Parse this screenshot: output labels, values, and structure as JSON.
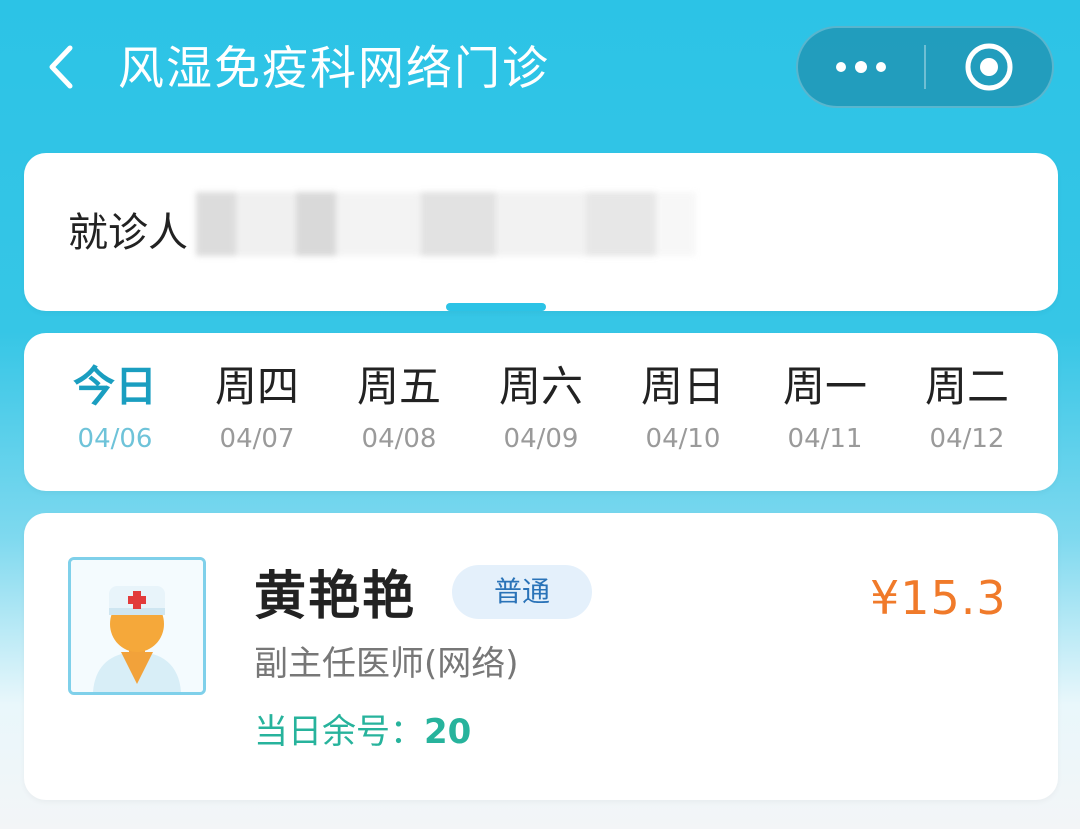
{
  "header": {
    "title": "风湿免疫科网络门诊",
    "back_icon": "chevron-left-icon",
    "more_icon": "more-dots-icon",
    "close_icon": "target-circle-icon"
  },
  "patient": {
    "label": "就诊人"
  },
  "dates": [
    {
      "name": "今日",
      "date": "04/06",
      "active": true
    },
    {
      "name": "周四",
      "date": "04/07"
    },
    {
      "name": "周五",
      "date": "04/08"
    },
    {
      "name": "周六",
      "date": "04/09"
    },
    {
      "name": "周日",
      "date": "04/10"
    },
    {
      "name": "周一",
      "date": "04/11"
    },
    {
      "name": "周二",
      "date": "04/12"
    }
  ],
  "doctor": {
    "name": "黄艳艳",
    "badge": "普通",
    "price": "¥15.3",
    "title": "副主任医师(网络)",
    "remaining_label": "当日余号：",
    "remaining_count": "20",
    "avatar_icon": "doctor-avatar-icon"
  },
  "colors": {
    "header_bg": "#2cc3e6",
    "accent": "#1a9ec0",
    "price": "#f07a2a",
    "remaining": "#27b39c",
    "badge_bg": "#e4f0fb",
    "badge_text": "#2a73b8"
  }
}
